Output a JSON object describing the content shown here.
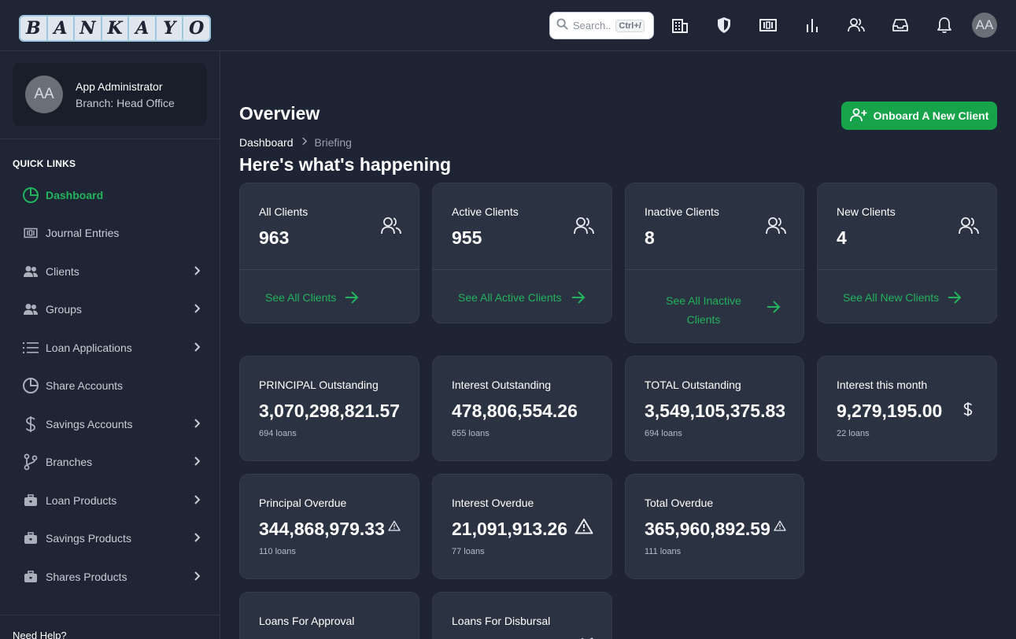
{
  "brand": {
    "letters": [
      "B",
      "A",
      "N",
      "K",
      "A",
      "Y",
      "O"
    ]
  },
  "search": {
    "placeholder": "Search..",
    "shortcut": "Ctrl+/"
  },
  "topbar_icons": [
    "building-icon",
    "shield-icon",
    "money-icon",
    "bar-chart-icon",
    "users-icon",
    "inbox-icon",
    "bell-icon"
  ],
  "user": {
    "initials": "AA",
    "name": "App Administrator",
    "branch": "Branch: Head Office"
  },
  "sidebar": {
    "quick_links_title": "QUICK LINKS",
    "items": [
      {
        "label": "Dashboard",
        "icon": "pie-chart-icon",
        "active": true,
        "expandable": false
      },
      {
        "label": "Journal Entries",
        "icon": "money-icon",
        "active": false,
        "expandable": false
      },
      {
        "label": "Clients",
        "icon": "users-icon",
        "active": false,
        "expandable": true
      },
      {
        "label": "Groups",
        "icon": "users-icon",
        "active": false,
        "expandable": true
      },
      {
        "label": "Loan Applications",
        "icon": "list-icon",
        "active": false,
        "expandable": true
      },
      {
        "label": "Share Accounts",
        "icon": "pie-chart-icon",
        "active": false,
        "expandable": false
      },
      {
        "label": "Savings Accounts",
        "icon": "dollar-icon",
        "active": false,
        "expandable": true
      },
      {
        "label": "Branches",
        "icon": "branch-icon",
        "active": false,
        "expandable": true
      },
      {
        "label": "Loan Products",
        "icon": "briefcase-icon",
        "active": false,
        "expandable": true
      },
      {
        "label": "Savings Products",
        "icon": "briefcase-icon",
        "active": false,
        "expandable": true
      },
      {
        "label": "Shares Products",
        "icon": "briefcase-icon",
        "active": false,
        "expandable": true
      }
    ],
    "help": "Need Help?"
  },
  "main": {
    "title": "Overview",
    "onboard_button": "Onboard A New Client",
    "breadcrumb": {
      "home": "Dashboard",
      "current": "Briefing"
    },
    "subtitle": "Here's what's happening",
    "client_cards": [
      {
        "label": "All Clients",
        "value": "963",
        "link": "See All Clients"
      },
      {
        "label": "Active Clients",
        "value": "955",
        "link": "See All Active Clients"
      },
      {
        "label": "Inactive Clients",
        "value": "8",
        "link": "See All Inactive Clients"
      },
      {
        "label": "New Clients",
        "value": "4",
        "link": "See All New Clients"
      }
    ],
    "outstanding_cards": [
      {
        "label": "PRINCIPAL Outstanding",
        "value": "3,070,298,821.57",
        "sub": "694 loans"
      },
      {
        "label": "Interest Outstanding",
        "value": "478,806,554.26",
        "sub": "655 loans"
      },
      {
        "label": "TOTAL Outstanding",
        "value": "3,549,105,375.83",
        "sub": "694 loans"
      },
      {
        "label": "Interest this month",
        "value": "9,279,195.00",
        "sub": "22 loans"
      }
    ],
    "overdue_cards": [
      {
        "label": "Principal Overdue",
        "value": "344,868,979.33",
        "sub": "110 loans"
      },
      {
        "label": "Interest Overdue",
        "value": "21,091,913.26",
        "sub": "77 loans"
      },
      {
        "label": "Total Overdue",
        "value": "365,960,892.59",
        "sub": "111 loans"
      }
    ],
    "pending_cards": [
      {
        "label": "Loans For Approval"
      },
      {
        "label": "Loans For Disbursal"
      }
    ]
  },
  "colors": {
    "accent": "#16a34a",
    "background": "#1e2433",
    "card": "#2b3242"
  }
}
